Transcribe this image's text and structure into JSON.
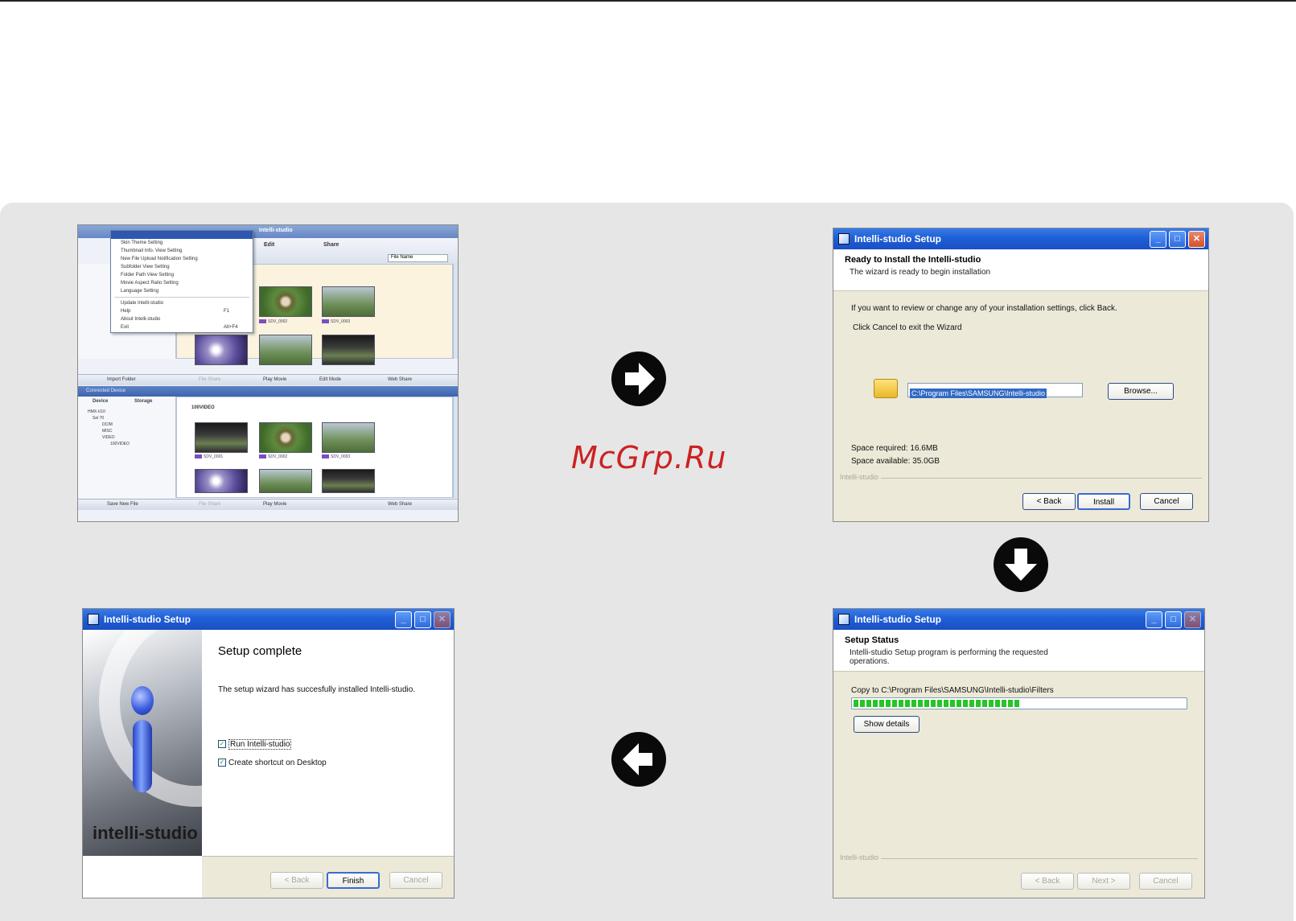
{
  "watermark": "McGrp.Ru",
  "app_window": {
    "title": "Intelli-studio",
    "menu_items": [
      "Skin Theme Setting",
      "Thumbnail Info. View Setting",
      "New File Upload Notification Setting",
      "Subfolder View Setting",
      "Folder Path View Setting",
      "Movie Aspect Ratio Setting",
      "Language Setting",
      "Update Intelli-studio",
      "Help",
      "About Intelli-studio",
      "Exit"
    ],
    "menu_shortcuts": {
      "help": "F1",
      "exit": "Alt+F4"
    },
    "toolbar_edit": "Edit",
    "toolbar_share": "Share",
    "sort_select": "File Name",
    "top_pane_buttons": [
      "Import Folder",
      "File Share",
      "Play Movie",
      "Edit Mode",
      "Web Share"
    ],
    "connected_device": "Connected Device",
    "device_tabs": [
      "Device",
      "Storage"
    ],
    "tree_items": [
      "HMX-U10",
      "Sel 70",
      "DCIM",
      "MISC",
      "VIDEO",
      "100VIDEO"
    ],
    "folder_label": "100VIDEO",
    "bottom_pane_buttons": [
      "Save New File",
      "File Share",
      "Play Movie",
      "Web Share"
    ],
    "thumb_captions": [
      "SDV_0001",
      "SDV_0002",
      "SDV_0003"
    ]
  },
  "ready_dialog": {
    "title": "Intelli-studio Setup",
    "heading": "Ready to Install the Intelli-studio",
    "subheading": "The wizard is ready to begin installation",
    "line1": "If you want to review or change any of your installation settings, click Back.",
    "line2": "Click Cancel to exit the Wizard",
    "path": "C:\\Program Files\\SAMSUNG\\Intelli-studio",
    "browse": "Browse...",
    "space_required": "Space required: 16.6MB",
    "space_available": "Space available: 35.0GB",
    "brand": "Intelli-studio",
    "back": "< Back",
    "install": "Install",
    "cancel": "Cancel"
  },
  "status_dialog": {
    "title": "Intelli-studio Setup",
    "heading": "Setup Status",
    "subheading": "Intelli-studio Setup program is performing the requested operations.",
    "copy_line": "Copy to C:\\Program Files\\SAMSUNG\\Intelli-studio\\Filters",
    "progress": 0.5,
    "show_details": "Show details",
    "brand": "Intelli-studio",
    "back": "< Back",
    "next": "Next >",
    "cancel": "Cancel"
  },
  "complete_dialog": {
    "title": "Intelli-studio Setup",
    "heading": "Setup complete",
    "message": "The setup wizard has succesfully installed Intelli-studio.",
    "check_run": "Run Intelli-studio",
    "check_shortcut": "Create shortcut on Desktop",
    "brand": "intelli-studio",
    "back": "< Back",
    "finish": "Finish",
    "cancel": "Cancel"
  },
  "colors": {
    "panel": "#e6e6e6",
    "arrow": "#0a0a0a",
    "xp_title": "#1f5fd6",
    "progress": "#27c427",
    "watermark": "#cc2222"
  },
  "icons": [
    "arrow-right-icon",
    "arrow-down-icon",
    "arrow-left-icon",
    "folder-icon",
    "app-icon"
  ]
}
